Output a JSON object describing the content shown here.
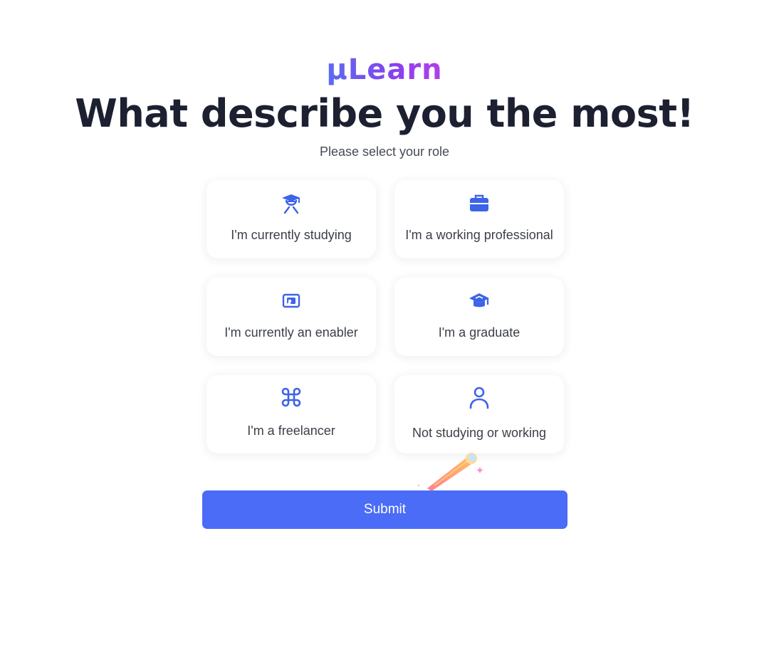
{
  "logo": {
    "text": "µLearn"
  },
  "title": "What describe you the most!",
  "subtitle": "Please select your role",
  "roles": [
    {
      "label": "I'm currently studying",
      "icon": "student-icon"
    },
    {
      "label": "I'm a working professional",
      "icon": "briefcase-icon"
    },
    {
      "label": "I'm currently an enabler",
      "icon": "presentation-board-icon"
    },
    {
      "label": "I'm a graduate",
      "icon": "graduation-cap-icon"
    },
    {
      "label": "I'm a freelancer",
      "icon": "command-key-icon"
    },
    {
      "label": "Not studying or working",
      "icon": "user-icon"
    }
  ],
  "submit_label": "Submit",
  "colors": {
    "accent": "#4a6cf7",
    "icon": "#3d63e8",
    "title": "#1c2030",
    "logo_gradient_start": "#5a6cf0",
    "logo_gradient_end": "#b040e8"
  }
}
